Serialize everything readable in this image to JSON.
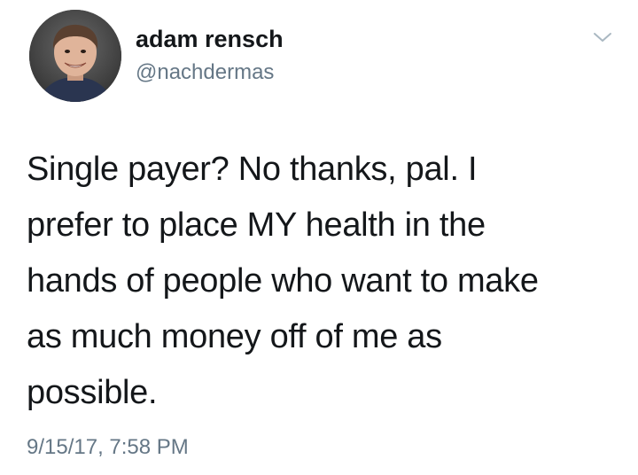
{
  "tweet": {
    "author": {
      "display_name": "adam rensch",
      "handle": "@nachdermas",
      "avatar_icon": "profile-photo-child"
    },
    "text": "Single payer? No thanks, pal. I\nprefer to place MY health in the\nhands of people who want to make\nas much money off of me as\npossible.",
    "timestamp": "9/15/17, 7:58 PM",
    "menu_icon": "chevron-down-icon"
  },
  "colors": {
    "text_primary": "#14171a",
    "text_secondary": "#657786",
    "background": "#ffffff"
  }
}
